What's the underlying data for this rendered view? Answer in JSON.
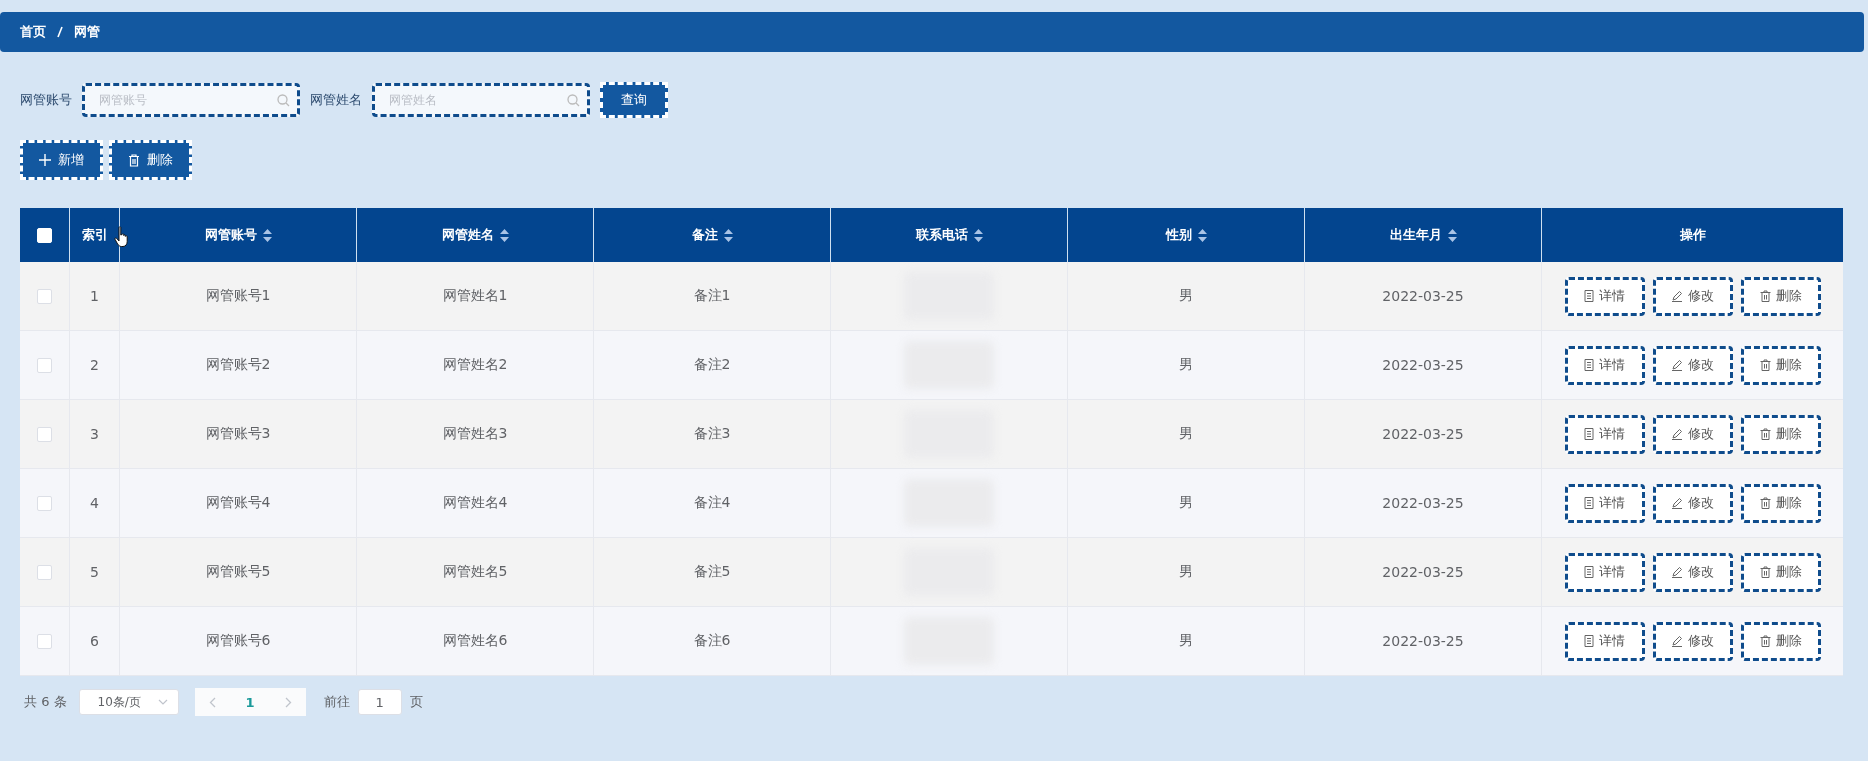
{
  "breadcrumb": [
    "首页",
    "网管"
  ],
  "search": {
    "fields": [
      {
        "label": "网管账号",
        "placeholder": "网管账号"
      },
      {
        "label": "网管姓名",
        "placeholder": "网管姓名"
      }
    ],
    "button": "查询"
  },
  "actions": [
    {
      "kind": "add",
      "label": "新增"
    },
    {
      "kind": "delete",
      "label": "删除"
    }
  ],
  "table": {
    "select_all": {
      "checked": false
    },
    "columns": [
      {
        "label": "索引",
        "sortable": false
      },
      {
        "label": "网管账号",
        "sortable": true
      },
      {
        "label": "网管姓名",
        "sortable": true
      },
      {
        "label": "备注",
        "sortable": true
      },
      {
        "label": "联系电话",
        "sortable": true
      },
      {
        "label": "性别",
        "sortable": true
      },
      {
        "label": "出生年月",
        "sortable": true
      },
      {
        "label": "操作",
        "sortable": false
      }
    ],
    "rows": [
      {
        "selected": false,
        "cells": [
          "1",
          "网管账号1",
          "网管姓名1",
          "备注1",
          "",
          "男",
          "2022-03-25"
        ],
        "actions": [
          {
            "kind": "detail",
            "label": "详情"
          },
          {
            "kind": "edit",
            "label": "修改"
          },
          {
            "kind": "delete",
            "label": "删除"
          }
        ]
      },
      {
        "selected": false,
        "cells": [
          "2",
          "网管账号2",
          "网管姓名2",
          "备注2",
          "",
          "男",
          "2022-03-25"
        ],
        "actions": [
          {
            "kind": "detail",
            "label": "详情"
          },
          {
            "kind": "edit",
            "label": "修改"
          },
          {
            "kind": "delete",
            "label": "删除"
          }
        ]
      },
      {
        "selected": false,
        "cells": [
          "3",
          "网管账号3",
          "网管姓名3",
          "备注3",
          "",
          "男",
          "2022-03-25"
        ],
        "actions": [
          {
            "kind": "detail",
            "label": "详情"
          },
          {
            "kind": "edit",
            "label": "修改"
          },
          {
            "kind": "delete",
            "label": "删除"
          }
        ]
      },
      {
        "selected": false,
        "cells": [
          "4",
          "网管账号4",
          "网管姓名4",
          "备注4",
          "",
          "男",
          "2022-03-25"
        ],
        "actions": [
          {
            "kind": "detail",
            "label": "详情"
          },
          {
            "kind": "edit",
            "label": "修改"
          },
          {
            "kind": "delete",
            "label": "删除"
          }
        ]
      },
      {
        "selected": false,
        "cells": [
          "5",
          "网管账号5",
          "网管姓名5",
          "备注5",
          "",
          "男",
          "2022-03-25"
        ],
        "actions": [
          {
            "kind": "detail",
            "label": "详情"
          },
          {
            "kind": "edit",
            "label": "修改"
          },
          {
            "kind": "delete",
            "label": "删除"
          }
        ]
      },
      {
        "selected": false,
        "cells": [
          "6",
          "网管账号6",
          "网管姓名6",
          "备注6",
          "",
          "男",
          "2022-03-25"
        ],
        "actions": [
          {
            "kind": "detail",
            "label": "详情"
          },
          {
            "kind": "edit",
            "label": "修改"
          },
          {
            "kind": "delete",
            "label": "删除"
          }
        ]
      }
    ]
  },
  "pagination": {
    "total": "共 6 条",
    "page_size": "10条/页",
    "pages": [
      {
        "label": "1",
        "selected": true
      }
    ],
    "goto_label": "前往",
    "goto_value": "1",
    "goto_suffix": "页"
  }
}
